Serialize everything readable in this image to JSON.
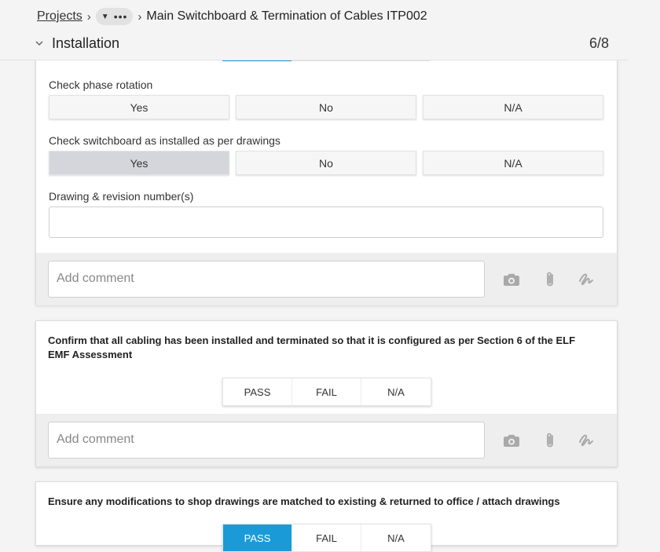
{
  "breadcrumb": {
    "projects": "Projects",
    "more_label": "•••",
    "current": "Main Switchboard & Termination of Cables ITP002"
  },
  "section": {
    "title": "Installation",
    "progress": "6/8"
  },
  "card1": {
    "q1": {
      "label": "Check phase rotation",
      "options": [
        "Yes",
        "No",
        "N/A"
      ],
      "selected": null
    },
    "q2": {
      "label": "Check switchboard as installed as per drawings",
      "options": [
        "Yes",
        "No",
        "N/A"
      ],
      "selected": "Yes"
    },
    "q3": {
      "label": "Drawing & revision number(s)",
      "value": ""
    },
    "comment_placeholder": "Add comment"
  },
  "card2": {
    "question": "Confirm that all cabling has been installed and terminated so that it is configured as per Section 6 of the ELF EMF Assessment",
    "options": [
      "PASS",
      "FAIL",
      "N/A"
    ],
    "comment_placeholder": "Add comment"
  },
  "card3": {
    "question": "Ensure any modifications to shop drawings are matched to existing & returned to office / attach drawings",
    "options": [
      "PASS",
      "FAIL",
      "N/A"
    ],
    "selected": "PASS"
  },
  "colors": {
    "accent": "#1a9bd7",
    "selected_grey": "#d4d6db",
    "icon_grey": "#a9a9a9"
  },
  "icons": [
    "chevron-down-icon",
    "camera-icon",
    "paperclip-icon",
    "signature-icon"
  ]
}
